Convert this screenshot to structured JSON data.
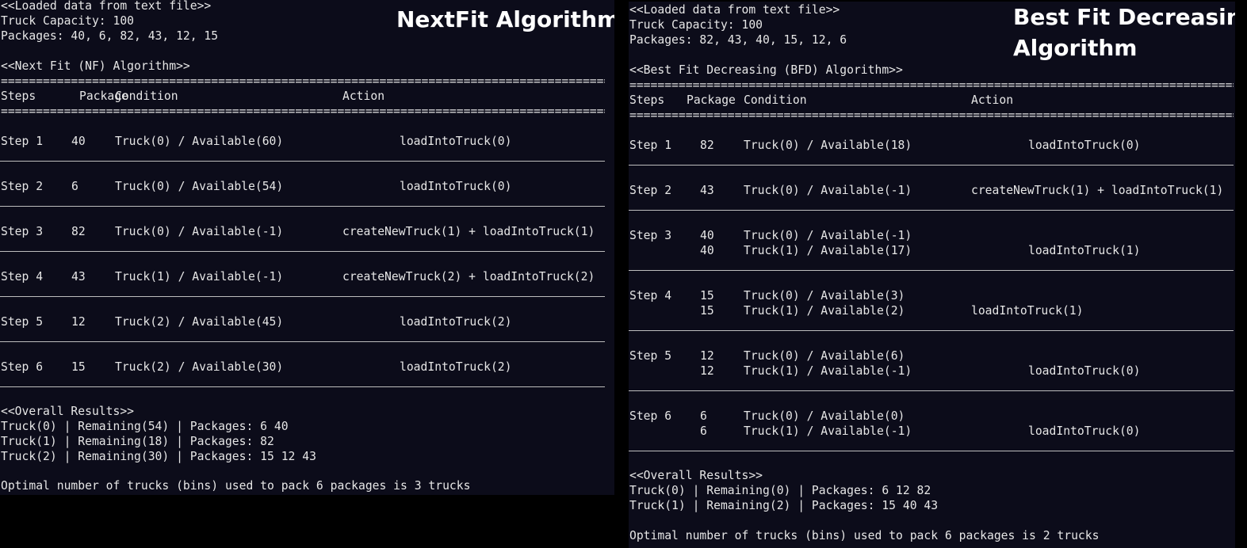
{
  "left": {
    "title": "NextFit Algorithm",
    "loaded": "<<Loaded data from text file>>",
    "capacity": "Truck Capacity: 100",
    "packages": "Packages: 40, 6, 82, 43, 12, 15",
    "algo": "<<Next Fit (NF) Algorithm>>",
    "equals": "===========================================================================================",
    "headers": {
      "steps": "Steps",
      "package": "Package",
      "condition": "Condition",
      "action": "Action"
    },
    "rows": [
      {
        "step": "Step 1",
        "package": "40",
        "condition": "Truck(0) / Available(60)",
        "action": "loadIntoTruck(0)"
      },
      {
        "step": "Step 2",
        "package": "6",
        "condition": "Truck(0) / Available(54)",
        "action": "loadIntoTruck(0)"
      },
      {
        "step": "Step 3",
        "package": "82",
        "condition": "Truck(0) / Available(-1)",
        "action": "createNewTruck(1) + loadIntoTruck(1)"
      },
      {
        "step": "Step 4",
        "package": "43",
        "condition": "Truck(1) / Available(-1)",
        "action": "createNewTruck(2) + loadIntoTruck(2)"
      },
      {
        "step": "Step 5",
        "package": "12",
        "condition": "Truck(2) / Available(45)",
        "action": "loadIntoTruck(2)"
      },
      {
        "step": "Step 6",
        "package": "15",
        "condition": "Truck(2) / Available(30)",
        "action": "loadIntoTruck(2)"
      }
    ],
    "results_header": "<<Overall Results>>",
    "results": [
      "Truck(0) | Remaining(54) | Packages: 6 40",
      "Truck(1) | Remaining(18) | Packages: 82",
      "Truck(2) | Remaining(30) | Packages: 15 12 43"
    ],
    "summary": "Optimal number of trucks (bins) used to pack 6 packages is 3 trucks"
  },
  "right": {
    "title_line1": "Best Fit Decreasing",
    "title_line2": "Algorithm",
    "loaded": "<<Loaded data from text file>>",
    "capacity": "Truck Capacity: 100",
    "packages": "Packages: 82, 43, 40, 15, 12, 6",
    "algo": "<<Best Fit Decreasing (BFD) Algorithm>>",
    "equals": "===========================================================================================",
    "headers": {
      "steps": "Steps",
      "package": "Package",
      "condition": "Condition",
      "action": "Action"
    },
    "rows": [
      {
        "step": "Step 1",
        "lines": [
          {
            "package": "82",
            "condition": "Truck(0) / Available(18)",
            "action": "loadIntoTruck(0)"
          }
        ]
      },
      {
        "step": "Step 2",
        "lines": [
          {
            "package": "43",
            "condition": "Truck(0) / Available(-1)",
            "action": "createNewTruck(1) + loadIntoTruck(1)"
          }
        ]
      },
      {
        "step": "Step 3",
        "lines": [
          {
            "package": "40",
            "condition": "Truck(0) / Available(-1)",
            "action": ""
          },
          {
            "package": "40",
            "condition": "Truck(1) / Available(17)",
            "action": "loadIntoTruck(1)"
          }
        ]
      },
      {
        "step": "Step 4",
        "lines": [
          {
            "package": "15",
            "condition": "Truck(0) / Available(3)",
            "action": ""
          },
          {
            "package": "15",
            "condition": "Truck(1) / Available(2)",
            "action": "loadIntoTruck(1)"
          }
        ]
      },
      {
        "step": "Step 5",
        "lines": [
          {
            "package": "12",
            "condition": "Truck(0) / Available(6)",
            "action": ""
          },
          {
            "package": "12",
            "condition": "Truck(1) / Available(-1)",
            "action": "loadIntoTruck(0)"
          }
        ]
      },
      {
        "step": "Step 6",
        "lines": [
          {
            "package": "6",
            "condition": "Truck(0) / Available(0)",
            "action": ""
          },
          {
            "package": "6",
            "condition": "Truck(1) / Available(-1)",
            "action": "loadIntoTruck(0)"
          }
        ]
      }
    ],
    "results_header": "<<Overall Results>>",
    "results": [
      "Truck(0) | Remaining(0) | Packages: 6 12 82",
      "Truck(1) | Remaining(2) | Packages: 15 40 43"
    ],
    "summary": "Optimal number of trucks (bins) used to pack 6 packages is 2 trucks"
  }
}
